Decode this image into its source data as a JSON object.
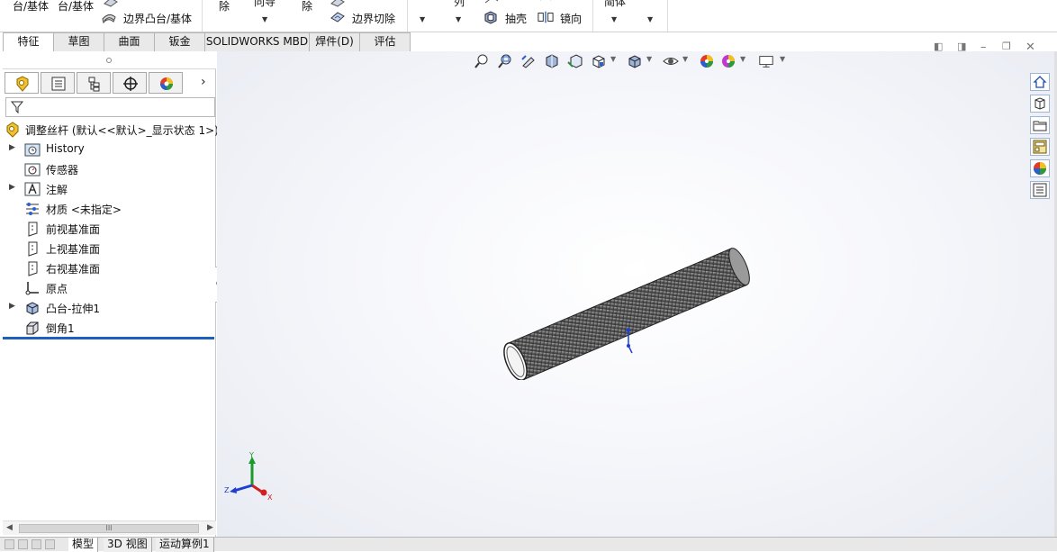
{
  "ribbon": {
    "items": [
      {
        "label": "台/基体"
      },
      {
        "label": "台/基体"
      },
      {
        "label": "边界凸台/基体"
      },
      {
        "label": "除"
      },
      {
        "label": "向导"
      },
      {
        "label": "除"
      },
      {
        "label": "边界切除"
      },
      {
        "label": "列"
      },
      {
        "label": "抽壳"
      },
      {
        "label": "镜向"
      },
      {
        "label": "简体"
      }
    ]
  },
  "command_tabs": [
    "特征",
    "草图",
    "曲面",
    "钣金",
    "SOLIDWORKS MBD",
    "焊件(D)",
    "评估"
  ],
  "active_tab": "特征",
  "feature_tree": {
    "root": "调整丝杆 (默认<<默认>_显示状态 1>)",
    "items": [
      {
        "label": "History",
        "icon": "history-folder-icon",
        "expandable": true
      },
      {
        "label": "传感器",
        "icon": "sensor-icon",
        "expandable": false
      },
      {
        "label": "注解",
        "icon": "annotation-icon",
        "expandable": true
      },
      {
        "label": "材质 <未指定>",
        "icon": "material-icon",
        "expandable": false
      },
      {
        "label": "前视基准面",
        "icon": "plane-icon",
        "expandable": false
      },
      {
        "label": "上视基准面",
        "icon": "plane-icon",
        "expandable": false
      },
      {
        "label": "右视基准面",
        "icon": "plane-icon",
        "expandable": false
      },
      {
        "label": "原点",
        "icon": "origin-icon",
        "expandable": false
      },
      {
        "label": "凸台-拉伸1",
        "icon": "extrude-icon",
        "expandable": true
      },
      {
        "label": "倒角1",
        "icon": "chamfer-icon",
        "expandable": false
      }
    ]
  },
  "hscroll_grip": "III",
  "bottom_tabs": [
    "模型",
    "3D 视图",
    "运动算例1"
  ],
  "active_bottom_tab": "模型",
  "triad": {
    "x": "X",
    "y": "Y",
    "z": "Z"
  },
  "colors": {
    "accent": "#1f5fbf",
    "model": "#6a6a6a",
    "x_axis": "#d02020",
    "y_axis": "#1a9a2a",
    "z_axis": "#1f3fd0"
  }
}
